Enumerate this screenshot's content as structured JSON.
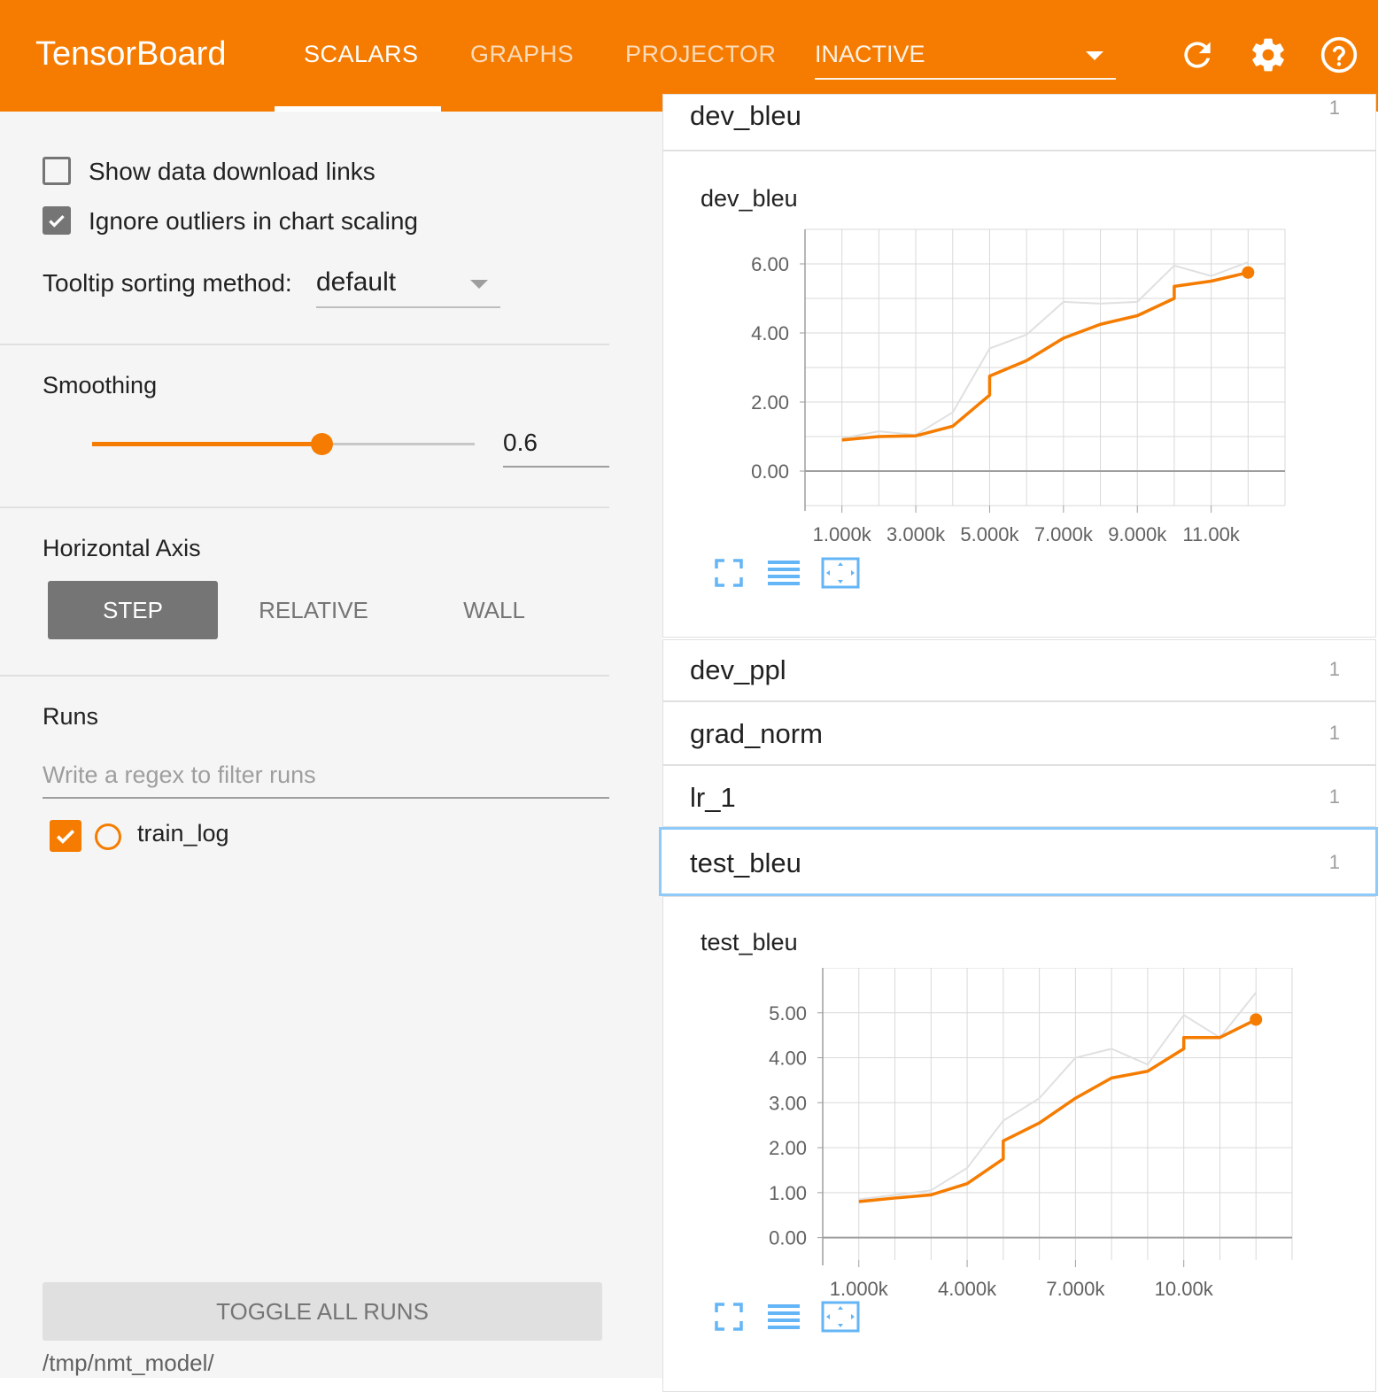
{
  "header": {
    "brand": "TensorBoard",
    "tabs": [
      {
        "label": "SCALARS",
        "active": true
      },
      {
        "label": "GRAPHS",
        "active": false
      },
      {
        "label": "PROJECTOR",
        "active": false
      }
    ],
    "inactive_label": "INACTIVE",
    "icons": [
      "refresh-icon",
      "gear-icon",
      "help-icon"
    ]
  },
  "sidebar": {
    "show_download_links": {
      "label": "Show data download links",
      "checked": false
    },
    "ignore_outliers": {
      "label": "Ignore outliers in chart scaling",
      "checked": true
    },
    "tooltip_sort": {
      "label": "Tooltip sorting method:",
      "value": "default"
    },
    "smoothing": {
      "title": "Smoothing",
      "value": "0.6",
      "fraction": 0.6
    },
    "horizontal_axis": {
      "title": "Horizontal Axis",
      "options": [
        "STEP",
        "RELATIVE",
        "WALL"
      ],
      "selected": "STEP"
    },
    "runs": {
      "title": "Runs",
      "filter_placeholder": "Write a regex to filter runs",
      "items": [
        {
          "name": "train_log",
          "checked": true
        }
      ]
    },
    "toggle_all_runs": "TOGGLE ALL RUNS",
    "logdir": "/tmp/nmt_model/"
  },
  "panes": [
    {
      "name": "dev_bleu",
      "count": "1"
    },
    {
      "name": "dev_ppl",
      "count": "1"
    },
    {
      "name": "grad_norm",
      "count": "1"
    },
    {
      "name": "lr_1",
      "count": "1"
    },
    {
      "name": "test_bleu",
      "count": "1"
    }
  ],
  "colors": {
    "accent": "#f57c00",
    "raw_line": "#e0e0e0",
    "selected_border": "#90caf9",
    "icon_blue": "#64b5f6"
  },
  "chart_data": [
    {
      "type": "line",
      "title": "dev_bleu",
      "xlabel": "",
      "ylabel": "",
      "xlim": [
        0,
        13000
      ],
      "ylim": [
        -1.0,
        7.0
      ],
      "x_ticks": [
        "1.000k",
        "3.000k",
        "5.000k",
        "7.000k",
        "9.000k",
        "11.00k"
      ],
      "y_ticks": [
        "0.00",
        "2.00",
        "4.00",
        "6.00"
      ],
      "series": [
        {
          "name": "",
          "role": "raw",
          "x": [
            1000,
            2000,
            3000,
            4000,
            5000,
            6000,
            7000,
            8000,
            9000,
            10000,
            11000,
            12000
          ],
          "y": [
            0.95,
            1.15,
            1.05,
            1.7,
            3.55,
            3.95,
            4.9,
            4.85,
            4.9,
            5.95,
            5.65,
            6.05
          ]
        },
        {
          "name": "",
          "role": "smoothed",
          "x": [
            1000,
            2000,
            3000,
            4000,
            5000,
            5000,
            6000,
            7000,
            8000,
            9000,
            10000,
            10000,
            11000,
            12000
          ],
          "y": [
            0.9,
            1.0,
            1.02,
            1.3,
            2.2,
            2.75,
            3.2,
            3.85,
            4.25,
            4.5,
            5.0,
            5.35,
            5.5,
            5.75
          ]
        }
      ],
      "grid": true,
      "legend": "none"
    },
    {
      "type": "line",
      "title": "test_bleu",
      "xlabel": "",
      "ylabel": "",
      "xlim": [
        0,
        13000
      ],
      "ylim": [
        -0.5,
        6.0
      ],
      "x_ticks": [
        "1.000k",
        "4.000k",
        "7.000k",
        "10.00k"
      ],
      "y_ticks": [
        "0.00",
        "1.00",
        "2.00",
        "3.00",
        "4.00",
        "5.00"
      ],
      "series": [
        {
          "name": "",
          "role": "raw",
          "x": [
            1000,
            2000,
            3000,
            4000,
            5000,
            6000,
            7000,
            8000,
            9000,
            10000,
            11000,
            12000
          ],
          "y": [
            0.85,
            0.95,
            1.05,
            1.55,
            2.6,
            3.1,
            4.0,
            4.2,
            3.85,
            4.95,
            4.45,
            5.45
          ]
        },
        {
          "name": "",
          "role": "smoothed",
          "x": [
            1000,
            2000,
            3000,
            4000,
            5000,
            5000,
            6000,
            7000,
            8000,
            9000,
            10000,
            10000,
            11000,
            12000
          ],
          "y": [
            0.8,
            0.88,
            0.95,
            1.2,
            1.75,
            2.15,
            2.55,
            3.1,
            3.55,
            3.7,
            4.2,
            4.45,
            4.45,
            4.85
          ]
        }
      ],
      "grid": true,
      "legend": "none"
    }
  ]
}
